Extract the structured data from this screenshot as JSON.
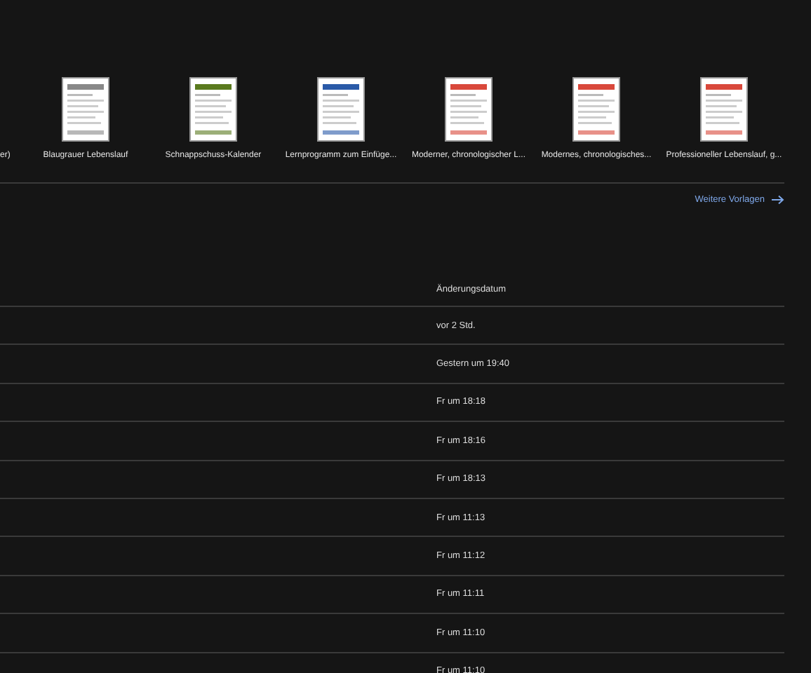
{
  "templates": [
    {
      "label": "er)",
      "thumbnail": false
    },
    {
      "label": "Blaugrauer Lebenslauf",
      "thumbnail": true
    },
    {
      "label": "Schnappschuss-Kalender",
      "thumbnail": true
    },
    {
      "label": "Lernprogramm zum Einfüge...",
      "thumbnail": true
    },
    {
      "label": "Moderner, chronologischer L...",
      "thumbnail": true
    },
    {
      "label": "Modernes, chronologisches...",
      "thumbnail": true
    },
    {
      "label": "Professioneller Lebenslauf, g...",
      "thumbnail": true
    }
  ],
  "more_templates_link": "Weitere Vorlagen",
  "table": {
    "columns": [
      "Änderungsdatum"
    ],
    "rows": [
      [
        "vor 2 Std."
      ],
      [
        "Gestern um 19:40"
      ],
      [
        "Fr um 18:18"
      ],
      [
        "Fr um 18:16"
      ],
      [
        "Fr um 18:13"
      ],
      [
        "Fr um 11:13"
      ],
      [
        "Fr um 11:12"
      ],
      [
        "Fr um 11:11"
      ],
      [
        "Fr um 11:10"
      ],
      [
        "Fr um 11:10"
      ]
    ]
  }
}
